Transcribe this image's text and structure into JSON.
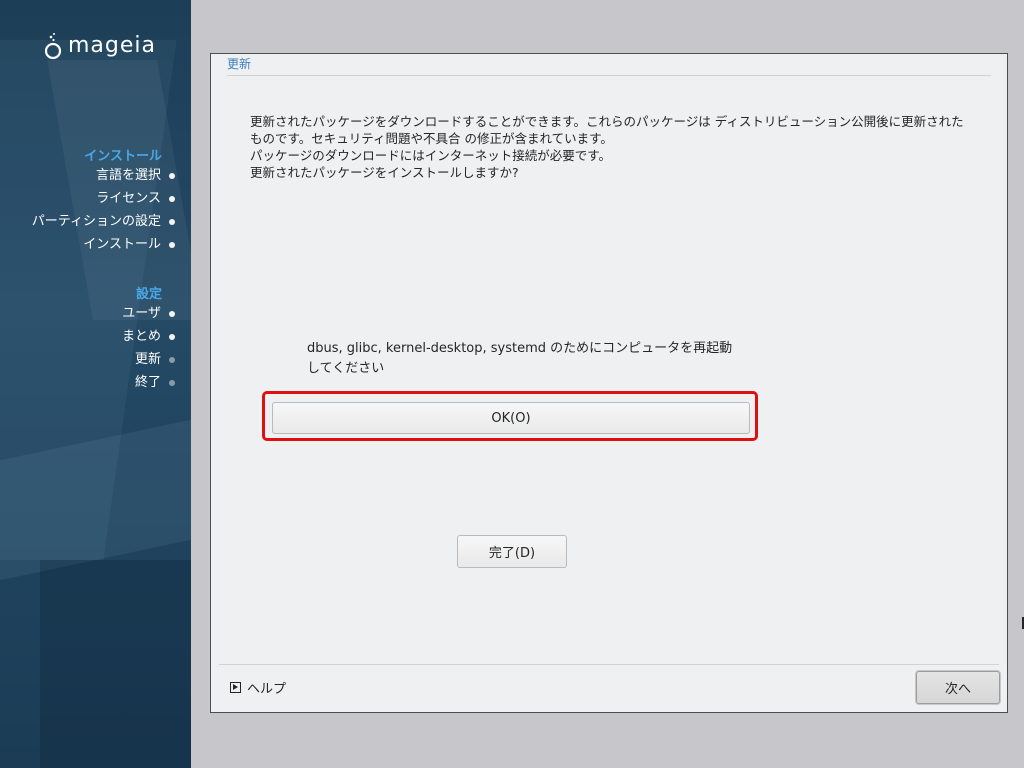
{
  "sidebar": {
    "logo_text": "mageia",
    "sections": [
      {
        "heading": "インストール",
        "items": [
          {
            "label": "言語を選択",
            "state": "done"
          },
          {
            "label": "ライセンス",
            "state": "done"
          },
          {
            "label": "パーティションの設定",
            "state": "done"
          },
          {
            "label": "インストール",
            "state": "done"
          }
        ]
      },
      {
        "heading": "設定",
        "items": [
          {
            "label": "ユーザ",
            "state": "done"
          },
          {
            "label": "まとめ",
            "state": "done"
          },
          {
            "label": "更新",
            "state": "current"
          },
          {
            "label": "終了",
            "state": "pending"
          }
        ]
      }
    ]
  },
  "dialog": {
    "title": "更新",
    "message_lines": [
      "更新されたパッケージをダウンロードすることができます。これらのパッケージは ディストリビューション公開後に更新された",
      "ものです。セキュリティ問題や不具合 の修正が含まれています。",
      "パッケージのダウンロードにはインターネット接続が必要です。",
      "更新されたパッケージをインストールしますか?"
    ],
    "reboot_lines": [
      "dbus, glibc, kernel-desktop, systemd のためにコンピュータを再起動",
      "してください"
    ],
    "ok_label": "OK(O)",
    "done_label": "完了(D)",
    "help_label": "ヘルプ",
    "next_label": "次へ"
  },
  "colors": {
    "accent_blue": "#4aa8e8",
    "highlight_red": "#e01010",
    "sidebar_bg": "#244a66"
  }
}
